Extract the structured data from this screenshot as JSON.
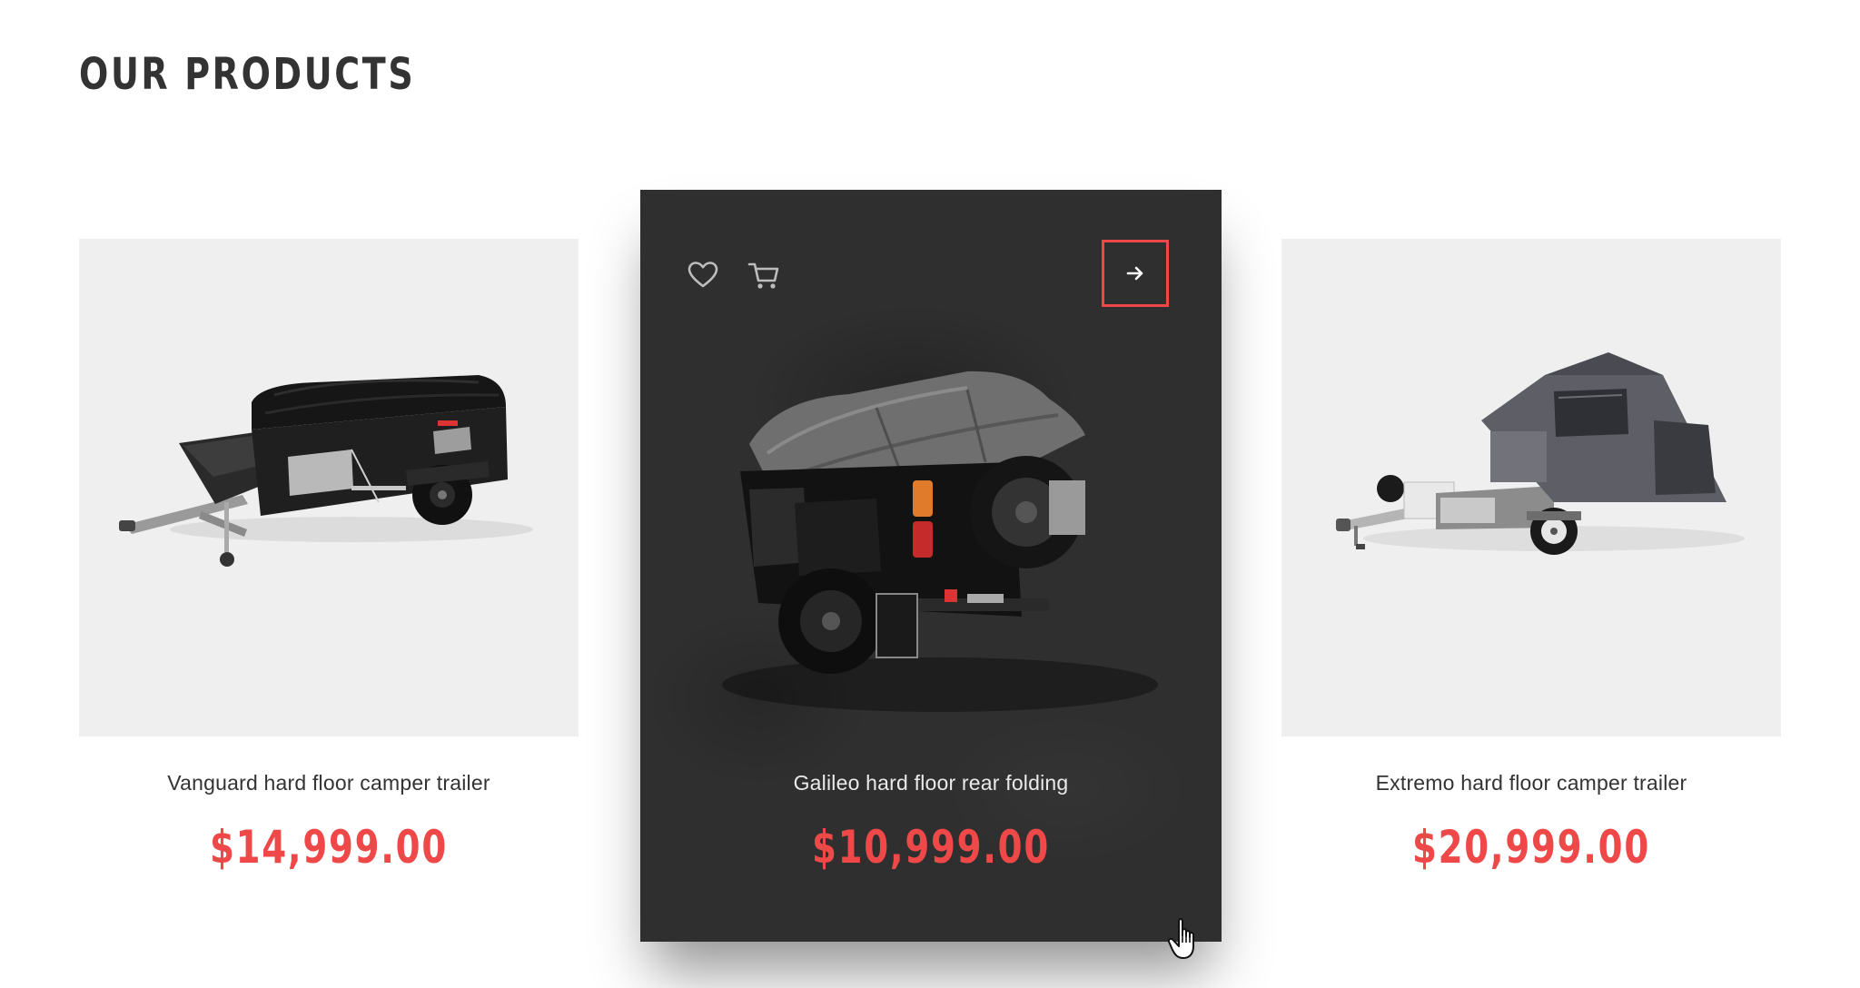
{
  "section": {
    "title": "OUR PRODUCTS"
  },
  "products": [
    {
      "name": "Vanguard hard floor camper trailer",
      "price": "$14,999.00",
      "image": "camper-trailer-covered-photo"
    },
    {
      "name": "Galileo hard floor rear folding",
      "price": "$10,999.00",
      "image": "black-series-rear-folding-trailer-photo",
      "featured": true,
      "actions": {
        "wishlist_icon": "heart-icon",
        "cart_icon": "cart-icon",
        "details_icon": "arrow-right-icon"
      }
    },
    {
      "name": "Extremo hard floor camper trailer",
      "price": "$20,999.00",
      "image": "camper-trailer-tent-open-photo"
    }
  ],
  "colors": {
    "accent": "#ef4848",
    "heading": "#333333",
    "featured_bg": "#2f2f2f",
    "image_bg": "#efefef"
  },
  "cursor": "pointer-hand-icon"
}
